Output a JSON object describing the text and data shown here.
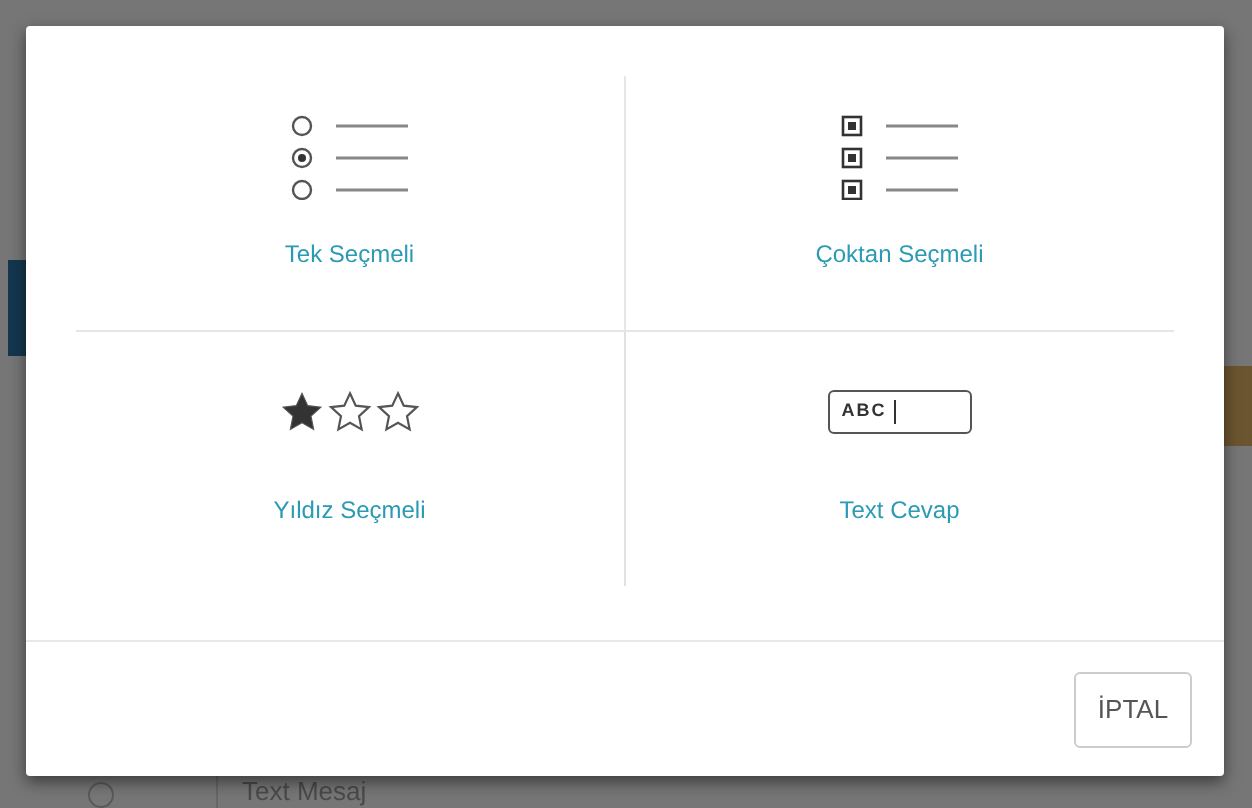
{
  "background": {
    "row_selected": false,
    "row_text": "Text Mesaj"
  },
  "dialog": {
    "options": [
      {
        "kind": "single",
        "label": "Tek Seçmeli"
      },
      {
        "kind": "multi",
        "label": "Çoktan Seçmeli"
      },
      {
        "kind": "rating",
        "label": "Yıldız Seçmeli",
        "stars": 1
      },
      {
        "kind": "text",
        "label": "Text Cevap"
      }
    ],
    "text_icon_sample": "ABC",
    "cancel_button": "İPTAL"
  }
}
